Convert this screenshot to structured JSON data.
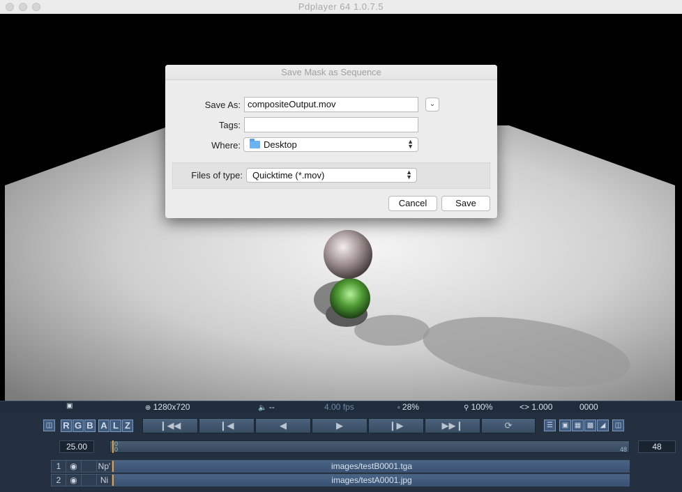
{
  "window": {
    "title": "Pdplayer 64 1.0.7.5"
  },
  "dialog": {
    "title": "Save Mask as Sequence",
    "save_as_label": "Save As:",
    "save_as_value": "compositeOutput.mov",
    "tags_label": "Tags:",
    "tags_value": "",
    "where_label": "Where:",
    "where_value": "Desktop",
    "where_icon": "folder-icon",
    "files_of_type_label": "Files of type:",
    "files_of_type_value": "Quicktime (*.mov)",
    "cancel_label": "Cancel",
    "save_label": "Save"
  },
  "status": {
    "resolution": "1280x720",
    "audio": "--",
    "fps": "4.00 fps",
    "memory": "28%",
    "zoom": "100%",
    "aspect": "1.000",
    "frame_counter": "0000"
  },
  "channels": [
    "R",
    "G",
    "B",
    "A",
    "L",
    "Z"
  ],
  "transport": {
    "first_icon": "skip-to-start-icon",
    "prev_frame_icon": "step-back-icon",
    "reverse_icon": "play-reverse-icon",
    "play_icon": "play-icon",
    "next_frame_icon": "step-forward-icon",
    "last_icon": "skip-to-end-icon",
    "loop_icon": "loop-icon"
  },
  "timeline": {
    "fps_value": "25.00",
    "start_marker": "0",
    "start_marker_sub": "0",
    "end_marker": "48",
    "end_frame": "48"
  },
  "layers": [
    {
      "index": "1",
      "mode": "Np'",
      "file": "images/testB0001.tga"
    },
    {
      "index": "2",
      "mode": "Ni",
      "file": "images/testA0001.jpg"
    }
  ]
}
